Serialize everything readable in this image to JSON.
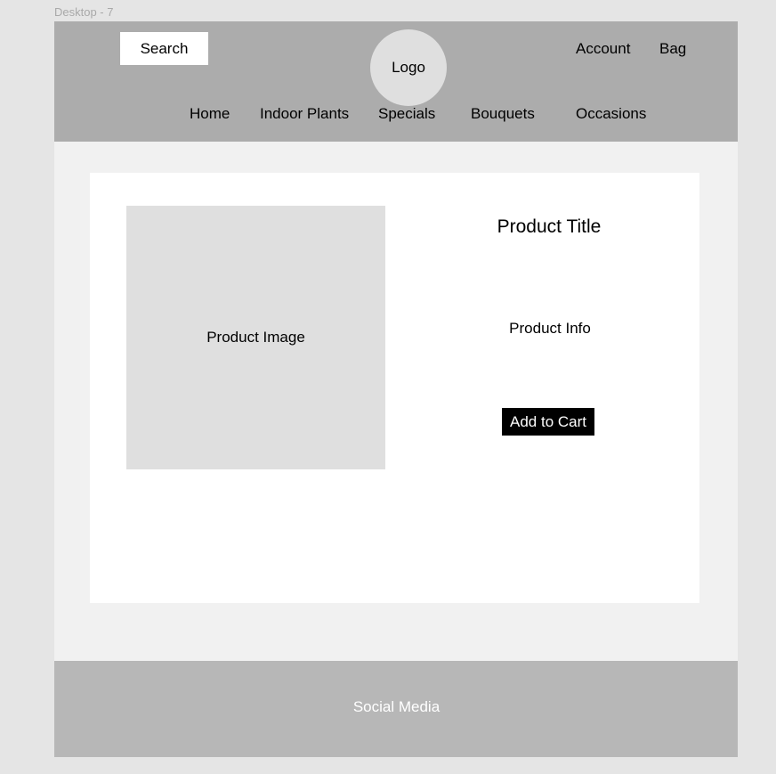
{
  "frame": {
    "label": "Desktop - 7"
  },
  "header": {
    "search_label": "Search",
    "logo_label": "Logo",
    "account_label": "Account",
    "bag_label": "Bag",
    "nav": [
      {
        "label": "Home"
      },
      {
        "label": "Indoor Plants"
      },
      {
        "label": "Specials"
      },
      {
        "label": "Bouquets"
      },
      {
        "label": "Occasions"
      }
    ]
  },
  "product": {
    "image_label": "Product Image",
    "title": "Product Title",
    "info": "Product Info",
    "add_to_cart_label": "Add to Cart"
  },
  "footer": {
    "label": "Social Media"
  },
  "colors": {
    "canvas_background": "#e5e5e5",
    "frame_background": "#f1f1f1",
    "header_background": "#acacac",
    "placeholder_fill": "#dfdfdf",
    "card_background": "#ffffff",
    "button_background": "#000000",
    "footer_background": "#b7b7b7"
  }
}
